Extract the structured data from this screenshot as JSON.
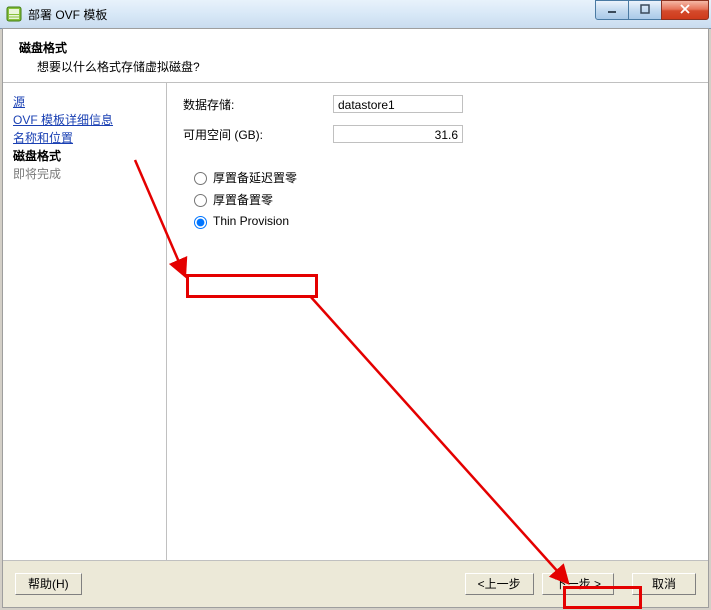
{
  "window": {
    "title": "部署 OVF 模板"
  },
  "header": {
    "title": "磁盘格式",
    "subtitle": "想要以什么格式存储虚拟磁盘?"
  },
  "nav": {
    "items": [
      {
        "label": "源",
        "kind": "link"
      },
      {
        "label": "OVF 模板详细信息",
        "kind": "link"
      },
      {
        "label": "名称和位置",
        "kind": "link"
      },
      {
        "label": "磁盘格式",
        "kind": "current"
      },
      {
        "label": "即将完成",
        "kind": "disabled"
      }
    ]
  },
  "content": {
    "datastore_label": "数据存储:",
    "datastore_value": "datastore1",
    "freespace_label": "可用空间 (GB):",
    "freespace_value": "31.6",
    "radios": {
      "r1": "厚置备延迟置零",
      "r2": "厚置备置零",
      "r3": "Thin Provision"
    },
    "selected": "r3"
  },
  "footer": {
    "help": "帮助(H)",
    "back": "<上一步",
    "next": "下一步 >",
    "cancel": "取消"
  }
}
